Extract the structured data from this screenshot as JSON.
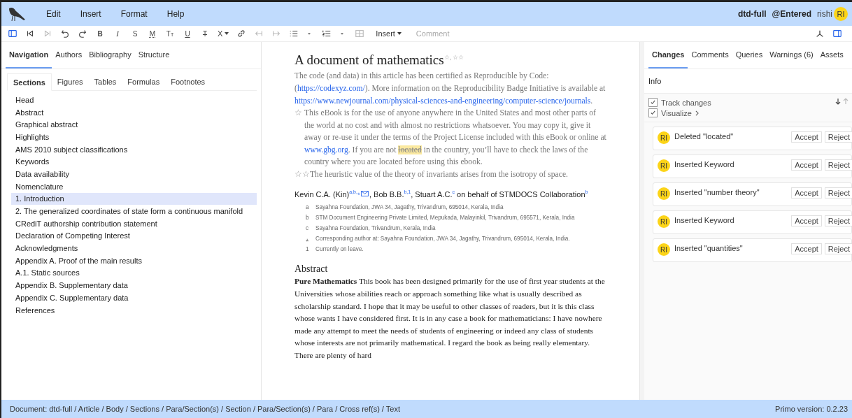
{
  "menubar": {
    "menus": [
      "Edit",
      "Insert",
      "Format",
      "Help"
    ],
    "document": "dtd-full",
    "state": "@Entered",
    "user": "rishi",
    "avatar": "RI"
  },
  "toolbar": {
    "items": [
      {
        "kind": "sidebar",
        "disabled": false
      },
      {
        "kind": "first",
        "disabled": false
      },
      {
        "kind": "last",
        "disabled": true
      },
      {
        "kind": "undo",
        "disabled": false
      },
      {
        "kind": "redo",
        "disabled": false
      },
      {
        "kind": "bold",
        "label": "B",
        "disabled": false
      },
      {
        "kind": "italic",
        "label": "I",
        "disabled": false
      },
      {
        "kind": "sans",
        "label": "S",
        "disabled": false
      },
      {
        "kind": "math",
        "label": "M",
        "disabled": false
      },
      {
        "kind": "smallcaps",
        "label": "Tt",
        "disabled": false
      },
      {
        "kind": "underline",
        "label": "U",
        "disabled": false
      },
      {
        "kind": "strike",
        "label": "T",
        "disabled": false
      },
      {
        "kind": "script",
        "label": "X",
        "disabled": false
      },
      {
        "kind": "link",
        "disabled": false
      },
      {
        "kind": "outdent",
        "disabled": true
      },
      {
        "kind": "indent",
        "disabled": true
      },
      {
        "kind": "bullets",
        "disabled": false
      },
      {
        "kind": "caret",
        "disabled": false
      },
      {
        "kind": "numbers",
        "disabled": false
      },
      {
        "kind": "caret",
        "disabled": false
      },
      {
        "kind": "table",
        "disabled": true
      }
    ],
    "insert_menu": "Insert",
    "comment": {
      "label": "Comment",
      "disabled": true
    },
    "right_items": [
      {
        "kind": "pdf"
      },
      {
        "kind": "sidebar"
      }
    ]
  },
  "left_panel": {
    "tabs": [
      {
        "label": "Navigation",
        "selected": true
      },
      {
        "label": "Authors",
        "selected": false
      },
      {
        "label": "Bibliography",
        "selected": false
      },
      {
        "label": "Structure",
        "selected": false
      }
    ],
    "subtabs": [
      {
        "label": "Sections",
        "selected": true
      },
      {
        "label": "Figures",
        "selected": false
      },
      {
        "label": "Tables",
        "selected": false
      },
      {
        "label": "Formulas",
        "selected": false
      },
      {
        "label": "Footnotes",
        "selected": false
      }
    ],
    "sections": [
      {
        "label": "Head",
        "selected": false
      },
      {
        "label": "Abstract",
        "selected": false
      },
      {
        "label": "Graphical abstract",
        "selected": false
      },
      {
        "label": "Highlights",
        "selected": false
      },
      {
        "label": "AMS 2010 subject classifications",
        "selected": false
      },
      {
        "label": "Keywords",
        "selected": false
      },
      {
        "label": "Data availability",
        "selected": false
      },
      {
        "label": "Nomenclature",
        "selected": false
      },
      {
        "label": "1. Introduction",
        "selected": true
      },
      {
        "label": "2. The generalized coordinates of state form a continuous manifold",
        "selected": false
      },
      {
        "label": "CRediT authorship contribution statement",
        "selected": false
      },
      {
        "label": "Declaration of Competing Interest",
        "selected": false
      },
      {
        "label": "Acknowledgments",
        "selected": false
      },
      {
        "label": "Appendix A. Proof of the main results",
        "selected": false
      },
      {
        "label": "A.1. Static sources",
        "selected": false
      },
      {
        "label": "Appendix B. Supplementary data",
        "selected": false
      },
      {
        "label": "Appendix C. Supplementary data",
        "selected": false
      },
      {
        "label": "References",
        "selected": false
      }
    ]
  },
  "document": {
    "title": "A document of mathematics$^{☆, ☆☆}$",
    "notes": [
      {
        "segments": [
          {
            "kind": "text",
            "text": "The code (and data) in this article has been certified as Reproducible by Code: ("
          },
          {
            "kind": "link",
            "text": "https://codexyz.com/"
          },
          {
            "kind": "text",
            "text": "). More information on the Reproducibility Badge Initiative is available at "
          },
          {
            "kind": "link",
            "text": "https://www.newjournal.com/physical-sciences-and-engineering/computer-science/journals"
          },
          {
            "kind": "text",
            "text": "."
          }
        ]
      },
      {
        "marker": "☆",
        "segments": [
          {
            "kind": "text",
            "text": "This eBook is for the use of anyone anywhere in the United States and most other parts of the world at no cost and with almost no restrictions whatsoever. You may copy it, give it away or re-use it under the terms of the Project License included with this eBook or online at "
          },
          {
            "kind": "link",
            "text": "www.gbg.org"
          },
          {
            "kind": "text",
            "text": ". If you are not "
          },
          {
            "kind": "deleted",
            "text": "located"
          },
          {
            "kind": "text",
            "text": " in the country, you’ll have to check the laws of the country where you are located before using this ebook."
          }
        ]
      },
      {
        "marker": "☆☆",
        "segments": [
          {
            "kind": "text",
            "text": "The heuristic value of the theory of invariants arises from the isotropy of space."
          }
        ]
      }
    ],
    "authors": [
      {
        "text": "Kevin C.A. (Kin)$^{a,b,⁎}$",
        "email": true
      },
      {
        "text": ", Bob B.B.$^{b,1}$, Stuart A.C.$^{c}$ on behalf of STMDOCS Collaboration$^{b}$",
        "email": false
      }
    ],
    "affiliations": [
      {
        "label": "a",
        "text": "Sayahna Foundation, JWA 34, Jagathy, Trivandrum, 695014, Kerala, India"
      },
      {
        "label": "b",
        "text": "STM Document Engineering Private Limited, Mepukada, Malayinkil, Trivandrum, 695571, Kerala, India"
      },
      {
        "label": "c",
        "text": "Sayahna Foundation, Trivandrum, Kerala, India"
      },
      {
        "label": "⁎",
        "text": "Corresponding author at: Sayahna Foundation, JWA 34, Jagathy, Trivandrum, 695014, Kerala, India."
      },
      {
        "label": "1",
        "text": "Currently on leave."
      }
    ],
    "abstract_heading": "Abstract",
    "abstract": "**Pure Mathematics** This book has been designed primarily for the use of first year students at the Universities whose abilities reach or approach something like what is usually described as scholarship standard. I hope that it may be useful to other classes of readers, but it is this class whose wants I have considered first. It is in any case a book for mathematicians: I have nowhere made any attempt to meet the needs of students of engineering or indeed any class of students whose interests are not primarily mathematical. I regard the book as being really elementary. There are plenty of hard"
  },
  "right_panel": {
    "tabs": [
      {
        "label": "Changes",
        "selected": true
      },
      {
        "label": "Comments",
        "selected": false
      },
      {
        "label": "Queries",
        "selected": false
      },
      {
        "label": "Warnings (6)",
        "selected": false
      },
      {
        "label": "Assets",
        "selected": false
      }
    ],
    "info": "Info",
    "options": [
      {
        "label": "Track changes",
        "checked": true,
        "chevron": false
      },
      {
        "label": "Visualize",
        "checked": true,
        "chevron": true
      }
    ],
    "changes": [
      {
        "avatar": "RI",
        "text": "Deleted \"located\"",
        "accept": "Accept",
        "reject": "Reject"
      },
      {
        "avatar": "RI",
        "text": "Inserted Keyword",
        "accept": "Accept",
        "reject": "Reject"
      },
      {
        "avatar": "RI",
        "text": "Inserted \"number theory\"",
        "accept": "Accept",
        "reject": "Reject"
      },
      {
        "avatar": "RI",
        "text": "Inserted Keyword",
        "accept": "Accept",
        "reject": "Reject"
      },
      {
        "avatar": "RI",
        "text": "Inserted \"quantities\"",
        "accept": "Accept",
        "reject": "Reject"
      }
    ]
  },
  "status_bar": {
    "path": "Document: dtd-full / Article / Body / Sections / Para/Section(s) / Section / Para/Section(s) / Para / Cross ref(s) / Text",
    "version": "Primo version: 0.2.23"
  }
}
